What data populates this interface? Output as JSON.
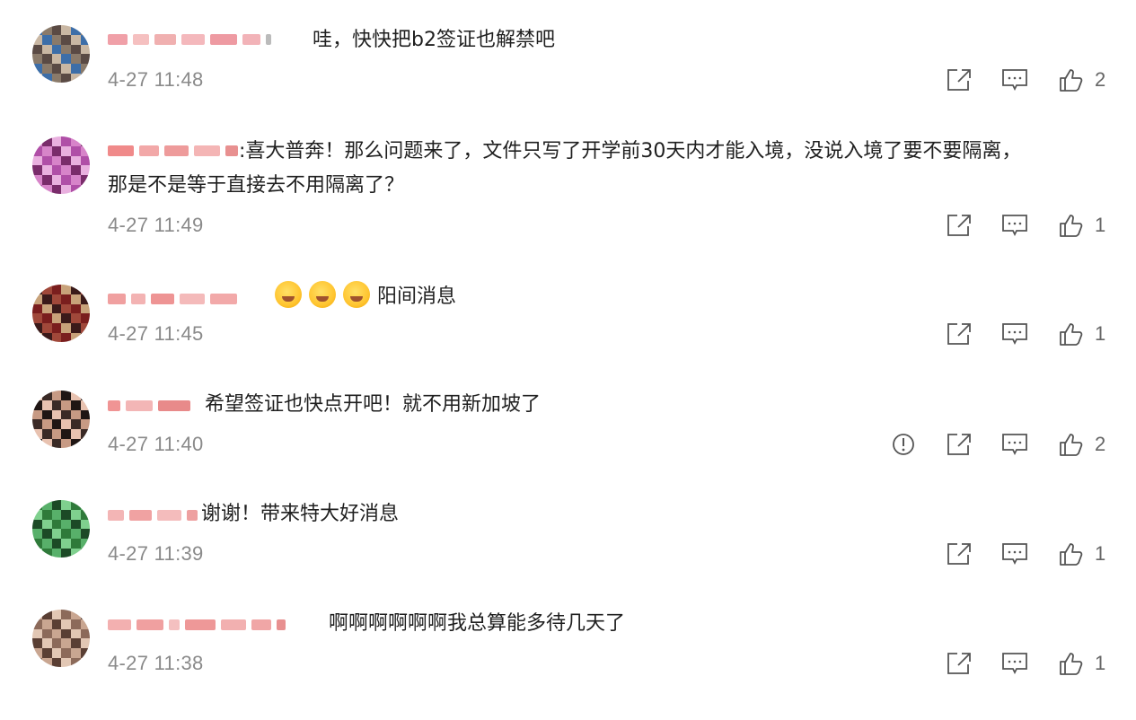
{
  "comments": [
    {
      "text": "哇，快快把b2签证也解禁吧",
      "text2": "",
      "time": "4-27 11:48",
      "likes": "2",
      "has_report": false,
      "avatar_colors": [
        "#3d6ea8",
        "#8a7a6a",
        "#5a4a44",
        "#c9b7a3"
      ]
    },
    {
      "text": ":喜大普奔！那么问题来了，文件只写了开学前30天内才能入境，没说入境了要不要隔离，",
      "text2": "那是不是等于直接去不用隔离了？",
      "time": "4-27 11:49",
      "likes": "1",
      "has_report": false,
      "avatar_colors": [
        "#b04fa7",
        "#d784c9",
        "#7a2c6b",
        "#e9b0df"
      ]
    },
    {
      "text": "阳间消息",
      "text2": "",
      "time": "4-27 11:45",
      "likes": "1",
      "has_report": false,
      "avatar_colors": [
        "#7a1e1e",
        "#c8a27a",
        "#3a1a1a",
        "#a0483a"
      ]
    },
    {
      "text": "希望签证也快点开吧！就不用新加坡了",
      "text2": "",
      "time": "4-27 11:40",
      "likes": "2",
      "has_report": true,
      "avatar_colors": [
        "#3a2a26",
        "#c79a84",
        "#1f1614",
        "#e8c2b0"
      ]
    },
    {
      "text": "谢谢！带来特大好消息",
      "text2": "",
      "time": "4-27 11:39",
      "likes": "1",
      "has_report": false,
      "avatar_colors": [
        "#2f7a3a",
        "#58b06a",
        "#1c4a26",
        "#7fd08e"
      ]
    },
    {
      "text": "啊啊啊啊啊啊我总算能多待几天了",
      "text2": "",
      "time": "4-27 11:38",
      "likes": "1",
      "has_report": false,
      "avatar_colors": [
        "#8c6a5a",
        "#c9a691",
        "#5a3f34",
        "#e2c7b4"
      ]
    }
  ],
  "icons": {
    "share": "share-icon",
    "reply": "reply-icon",
    "like": "like-icon",
    "report": "report-icon"
  },
  "colors": {
    "icon": "#555555",
    "time": "#8a8a8a",
    "text": "#1f1f1f"
  }
}
